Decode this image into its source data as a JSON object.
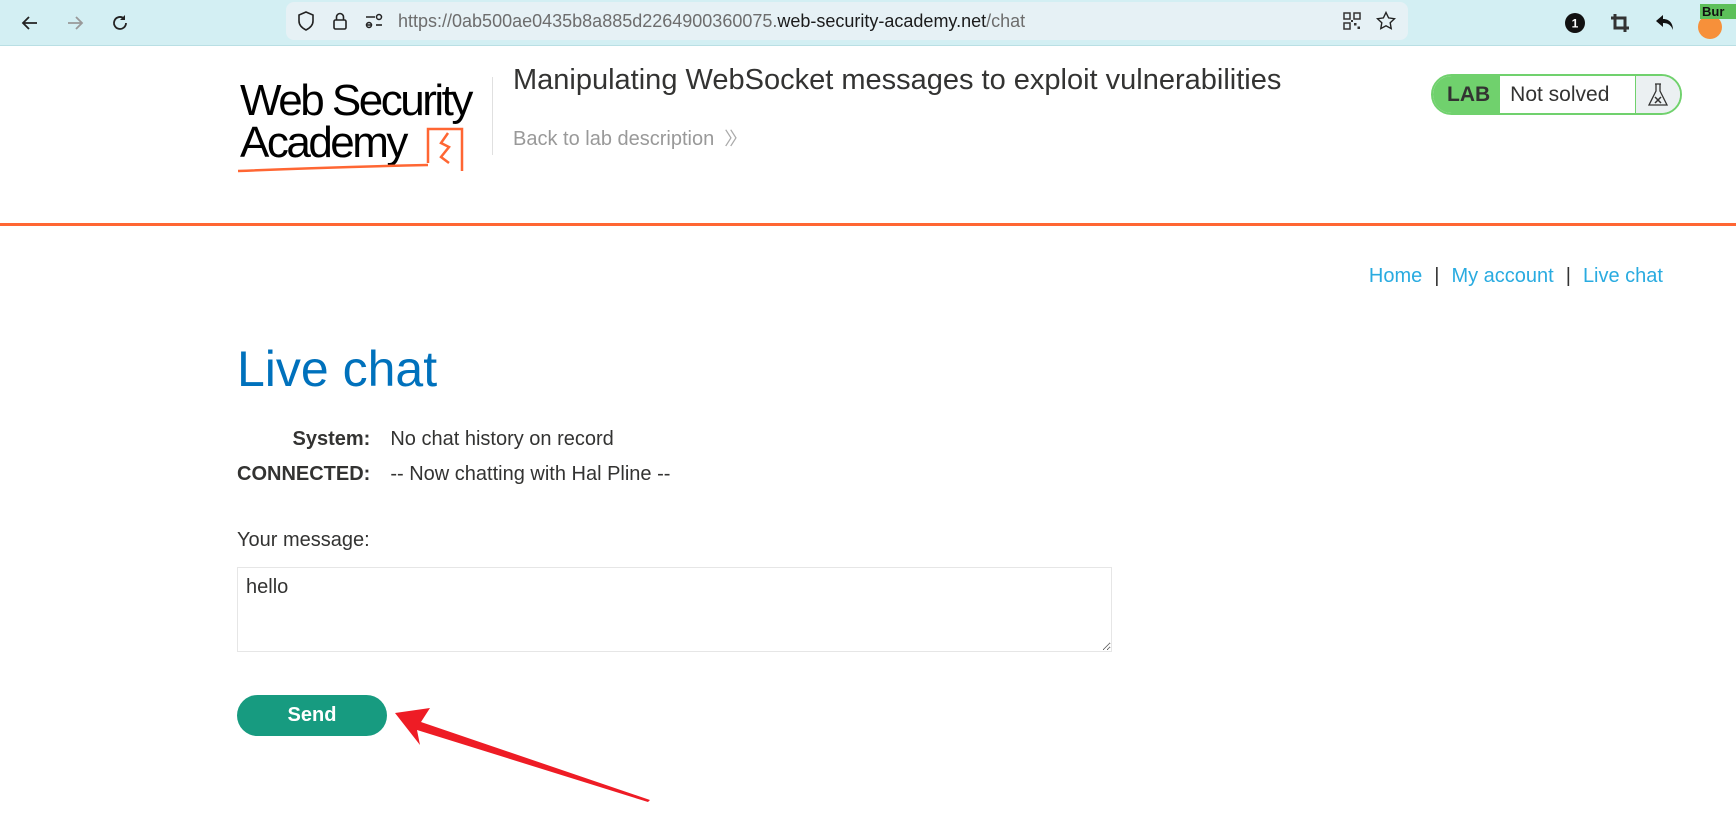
{
  "browser": {
    "url_prefix": "https://0ab500ae0435b8a885d2264900360075.",
    "url_host": "web-security-academy.net",
    "url_path": "/chat",
    "extensions": {
      "badge_count": "1",
      "burp_label": "Bur"
    },
    "icons": [
      "back-icon",
      "forward-icon",
      "reload-icon",
      "shield-icon",
      "lock-icon",
      "permissions-icon",
      "qr-code-icon",
      "bookmark-star-icon",
      "notification-badge-icon",
      "crop-icon",
      "undo-icon",
      "burp-extension-icon"
    ]
  },
  "header": {
    "logo_line1": "Web Security",
    "logo_line2": "Academy",
    "lab_title": "Manipulating WebSocket messages to exploit vulnerabilities",
    "back_link": "Back to lab description",
    "back_chevron": "»",
    "lab_badge": {
      "tag": "LAB",
      "status": "Not solved"
    }
  },
  "nav": {
    "items": [
      {
        "label": "Home"
      },
      {
        "label": "My account"
      },
      {
        "label": "Live chat"
      }
    ],
    "separator": "|"
  },
  "main": {
    "title": "Live chat",
    "messages": [
      {
        "from": "System:",
        "text": "No chat history on record"
      },
      {
        "from": "CONNECTED:",
        "text": "-- Now chatting with Hal Pline --"
      }
    ],
    "message_label": "Your message:",
    "message_value": "hello",
    "send_label": "Send"
  },
  "colors": {
    "accent_orange": "#ff6633",
    "title_blue": "#0071bc",
    "link_blue": "#29abe0",
    "button_green": "#179b80",
    "lab_green": "#70d16d",
    "annotation_red": "#ee1c25"
  }
}
